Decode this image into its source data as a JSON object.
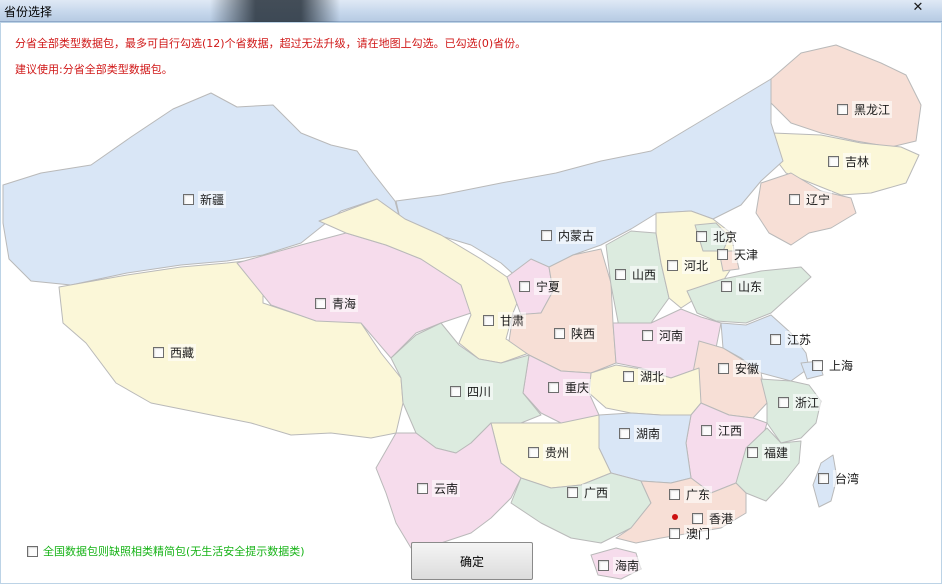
{
  "window": {
    "title": "省份选择",
    "close_glyph": "✕"
  },
  "notice": {
    "line1": "分省全部类型数据包，最多可自行勾选(12)个省数据，超过无法升级，请在地图上勾选。已勾选(0)省份。",
    "line2": "建议使用:分省全部类型数据包。"
  },
  "colors": {
    "notice_text": "#d01818",
    "option_text": "#17b317",
    "region_blue": "#d9e6f6",
    "region_pink": "#f6dcec",
    "region_yellow": "#fbf7d8",
    "region_green": "#dcebdf",
    "region_peach": "#f7dfd6"
  },
  "provinces": [
    {
      "id": "heilongjiang",
      "name": "黑龙江",
      "checked": false
    },
    {
      "id": "jilin",
      "name": "吉林",
      "checked": false
    },
    {
      "id": "liaoning",
      "name": "辽宁",
      "checked": false
    },
    {
      "id": "xinjiang",
      "name": "新疆",
      "checked": false
    },
    {
      "id": "neimenggu",
      "name": "内蒙古",
      "checked": false
    },
    {
      "id": "beijing",
      "name": "北京",
      "checked": false
    },
    {
      "id": "tianjin",
      "name": "天津",
      "checked": false
    },
    {
      "id": "hebei",
      "name": "河北",
      "checked": false
    },
    {
      "id": "shanxi",
      "name": "山西",
      "checked": false
    },
    {
      "id": "shandong",
      "name": "山东",
      "checked": false
    },
    {
      "id": "ningxia",
      "name": "宁夏",
      "checked": false
    },
    {
      "id": "qinghai",
      "name": "青海",
      "checked": false
    },
    {
      "id": "gansu",
      "name": "甘肃",
      "checked": false
    },
    {
      "id": "shaanxi",
      "name": "陕西",
      "checked": false
    },
    {
      "id": "henan",
      "name": "河南",
      "checked": false
    },
    {
      "id": "jiangsu",
      "name": "江苏",
      "checked": false
    },
    {
      "id": "xizang",
      "name": "西藏",
      "checked": false
    },
    {
      "id": "shanghai",
      "name": "上海",
      "checked": false
    },
    {
      "id": "anhui",
      "name": "安徽",
      "checked": false
    },
    {
      "id": "sichuan",
      "name": "四川",
      "checked": false
    },
    {
      "id": "chongqing",
      "name": "重庆",
      "checked": false
    },
    {
      "id": "hubei",
      "name": "湖北",
      "checked": false
    },
    {
      "id": "zhejiang",
      "name": "浙江",
      "checked": false
    },
    {
      "id": "jiangxi",
      "name": "江西",
      "checked": false
    },
    {
      "id": "hunan",
      "name": "湖南",
      "checked": false
    },
    {
      "id": "guizhou",
      "name": "贵州",
      "checked": false
    },
    {
      "id": "fujian",
      "name": "福建",
      "checked": false
    },
    {
      "id": "taiwan",
      "name": "台湾",
      "checked": false
    },
    {
      "id": "yunnan",
      "name": "云南",
      "checked": false
    },
    {
      "id": "guangxi",
      "name": "广西",
      "checked": false
    },
    {
      "id": "guangdong",
      "name": "广东",
      "checked": false
    },
    {
      "id": "xianggang",
      "name": "香港",
      "checked": false
    },
    {
      "id": "aomen",
      "name": "澳门",
      "checked": false
    },
    {
      "id": "hainan",
      "name": "海南",
      "checked": false
    }
  ],
  "bottom_option": {
    "label": "全国数据包则缺照相类精简包(无生活安全提示数据类)",
    "checked": false
  },
  "ok_button": {
    "label": "确定"
  }
}
